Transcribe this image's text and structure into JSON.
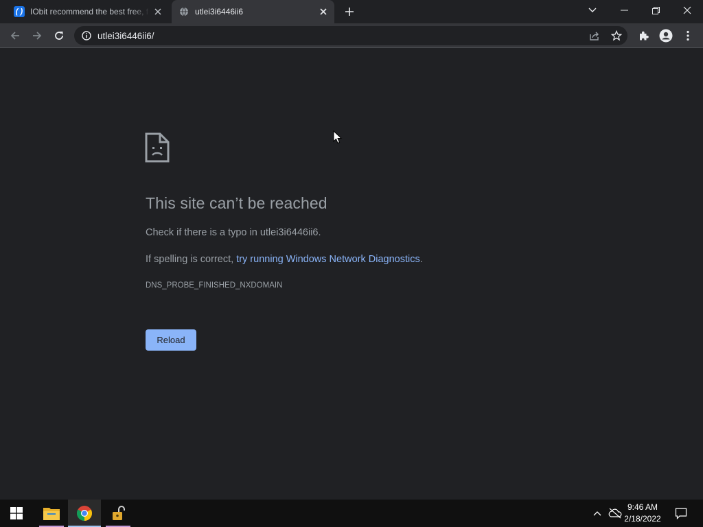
{
  "tabs": [
    {
      "title": "IObit recommend the best free, f",
      "active": false,
      "favicon": "iobit-icon"
    },
    {
      "title": "utlei3i6446ii6",
      "active": true,
      "favicon": "globe-icon"
    }
  ],
  "address_bar": {
    "url": "utlei3i6446ii6/"
  },
  "error_page": {
    "title": "This site can’t be reached",
    "typo_text": "Check if there is a typo in utlei3i6446ii6.",
    "spelling_prefix": "If spelling is correct, ",
    "diagnostics_link": "try running Windows Network Diagnostics",
    "spelling_suffix": ".",
    "error_code": "DNS_PROBE_FINISHED_NXDOMAIN",
    "reload_label": "Reload"
  },
  "taskbar": {
    "time": "9:46 AM",
    "date": "2/18/2022"
  },
  "colors": {
    "page_bg": "#202124",
    "toolbar_bg": "#35363a",
    "link": "#8ab4f8",
    "text_muted": "#9aa0a6"
  }
}
